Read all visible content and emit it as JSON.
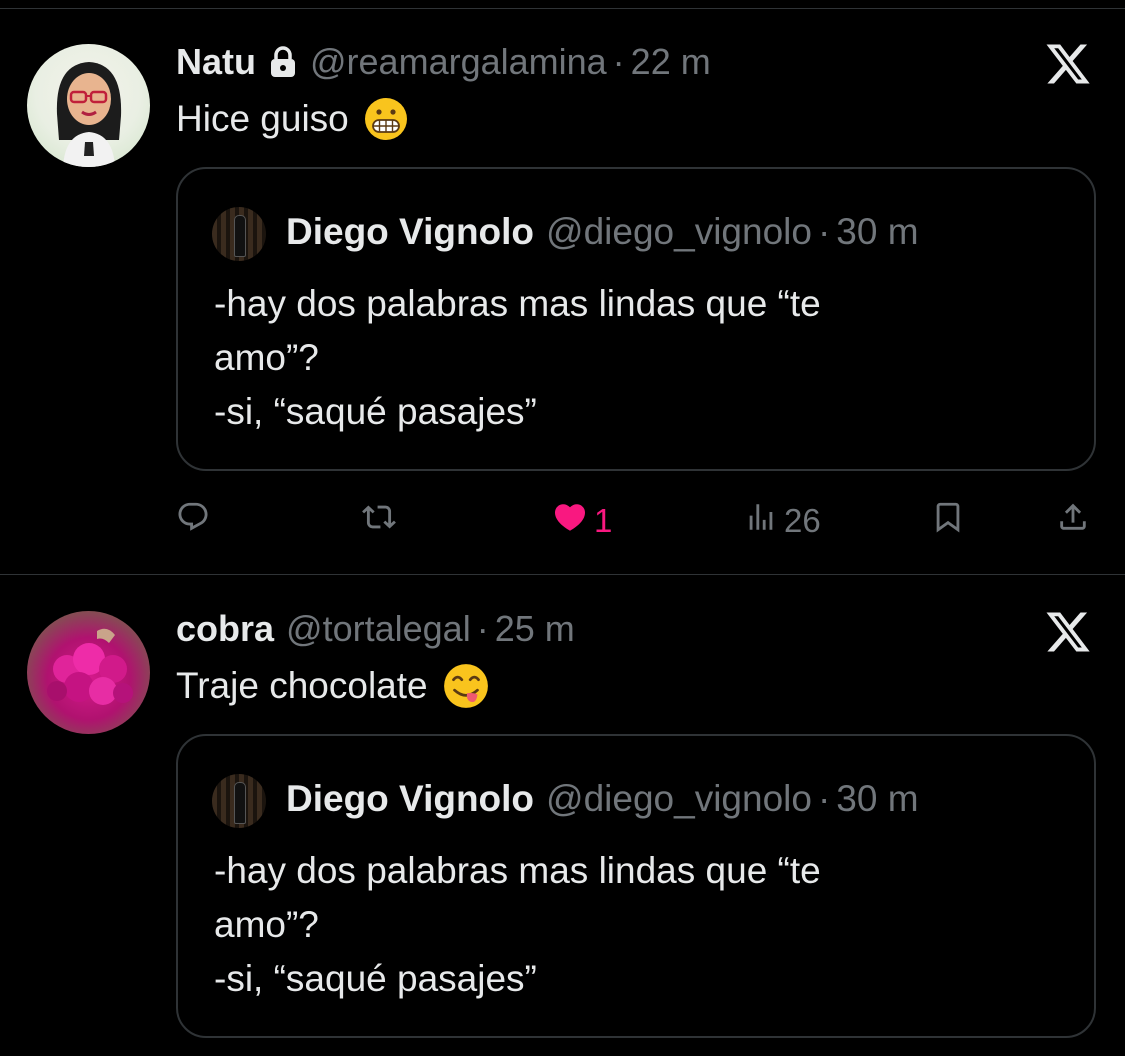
{
  "tweets": [
    {
      "name": "Natu",
      "handle": "@reamargalamina",
      "separator": "·",
      "time": "22 m",
      "text": "Hice guiso",
      "emoji": "grimacing-face",
      "protected": true,
      "quote": {
        "name": "Diego Vignolo",
        "handle": "@diego_vignolo",
        "separator": "·",
        "time": "30 m",
        "text": "-hay dos palabras mas lindas que “te\namo”?\n-si, “saqué pasajes”"
      },
      "actions": {
        "likes": "1",
        "views": "26"
      }
    },
    {
      "name": "cobra",
      "handle": "@tortalegal",
      "separator": "·",
      "time": "25 m",
      "text": "Traje chocolate",
      "emoji": "face-savoring-food",
      "quote": {
        "name": "Diego Vignolo",
        "handle": "@diego_vignolo",
        "separator": "·",
        "time": "30 m",
        "text": "-hay dos palabras mas lindas que “te\namo”?\n-si, “saqué pasajes”"
      }
    }
  ],
  "colors": {
    "background": "#000000",
    "text": "#e7e9ea",
    "muted": "#71767b",
    "border": "#2f3336",
    "like": "#f91880"
  }
}
